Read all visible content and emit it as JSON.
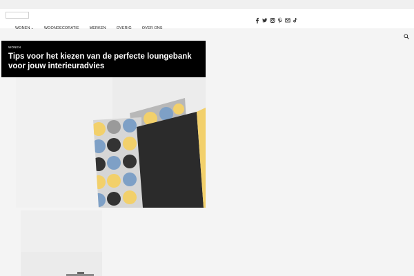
{
  "header": {
    "logo_alt": "",
    "social_icons": [
      "facebook-icon",
      "twitter-icon",
      "instagram-icon",
      "pinterest-icon",
      "email-icon",
      "tiktok-icon"
    ]
  },
  "nav": {
    "items": [
      {
        "label": "WONEN",
        "has_dropdown": true
      },
      {
        "label": "WOONDECORATIE"
      },
      {
        "label": "MERKEN"
      },
      {
        "label": "OVERIG"
      },
      {
        "label": "OVER ONS"
      }
    ]
  },
  "article": {
    "category": "WONEN",
    "title": "Tips voor het kiezen van de perfecte loungebank voor jouw interieuradvies"
  },
  "colors": {
    "background": "#f4f4f4",
    "title_box": "#000000",
    "accent_yellow": "#f2d06b",
    "accent_blue": "#7ea0c6"
  }
}
